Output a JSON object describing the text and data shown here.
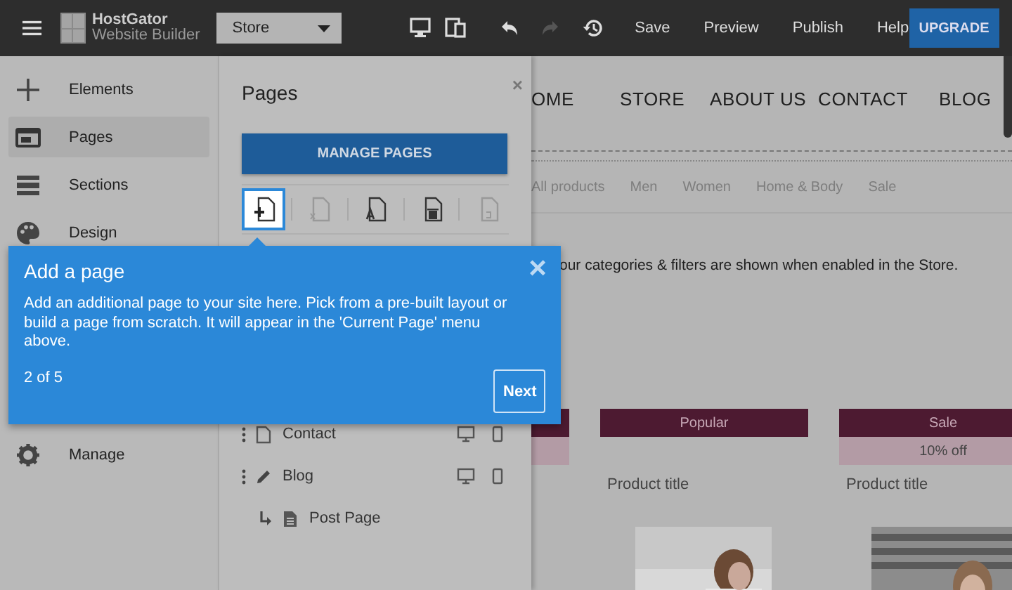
{
  "topbar": {
    "brand": {
      "name": "HostGator",
      "subtitle": "Website Builder"
    },
    "page_select": {
      "value": "Store"
    },
    "devices": [
      {
        "kind": "desktop"
      },
      {
        "kind": "tablet"
      }
    ],
    "history": [
      {
        "kind": "undo",
        "disabled": false
      },
      {
        "kind": "redo",
        "disabled": true
      },
      {
        "kind": "history",
        "disabled": false
      }
    ],
    "actions": [
      "Save",
      "Preview",
      "Publish",
      "Help"
    ],
    "upgrade": "UPGRADE"
  },
  "sidebar": {
    "items": [
      {
        "kind": "plus",
        "label": "Elements",
        "selected": false
      },
      {
        "kind": "pages",
        "label": "Pages",
        "selected": true
      },
      {
        "kind": "sections",
        "label": "Sections",
        "selected": false
      },
      {
        "kind": "palette",
        "label": "Design",
        "selected": false
      },
      {
        "kind": "gear",
        "label": "Manage",
        "selected": false
      }
    ]
  },
  "pages_panel": {
    "title": "Pages",
    "close": "×",
    "button": "MANAGE PAGES",
    "tools": [
      {
        "kind": "add",
        "selected": true
      },
      {
        "kind": "duplicate",
        "selected": false
      },
      {
        "kind": "rename",
        "selected": false
      },
      {
        "kind": "delete",
        "selected": false
      },
      {
        "kind": "restore",
        "selected": false
      }
    ],
    "pages": [
      {
        "kind": "page",
        "name": "Contact"
      },
      {
        "kind": "blog",
        "name": "Blog",
        "children": [
          {
            "kind": "post",
            "name": "Post Page"
          }
        ]
      }
    ]
  },
  "site": {
    "nav": [
      "OME",
      "STORE",
      "ABOUT US",
      "CONTACT",
      "BLOG"
    ],
    "filters": [
      "All products",
      "Men",
      "Women",
      "Home & Body",
      "Sale"
    ],
    "note": "our categories & filters are shown when enabled in the Store.",
    "products": [
      {
        "kind": "cut"
      },
      {
        "kind": "card",
        "badge": "Popular",
        "title": "Product title"
      },
      {
        "kind": "card",
        "badge": "Sale",
        "discount": "10% off",
        "title": "Product title"
      }
    ]
  },
  "tour": {
    "title": "Add a page",
    "close": "×",
    "text": "Add an additional page to your site here. Pick from a pre-built layout or build a page from scratch. It will appear in the 'Current Page' menu above.",
    "step": "2 of 5",
    "button": "Next"
  }
}
